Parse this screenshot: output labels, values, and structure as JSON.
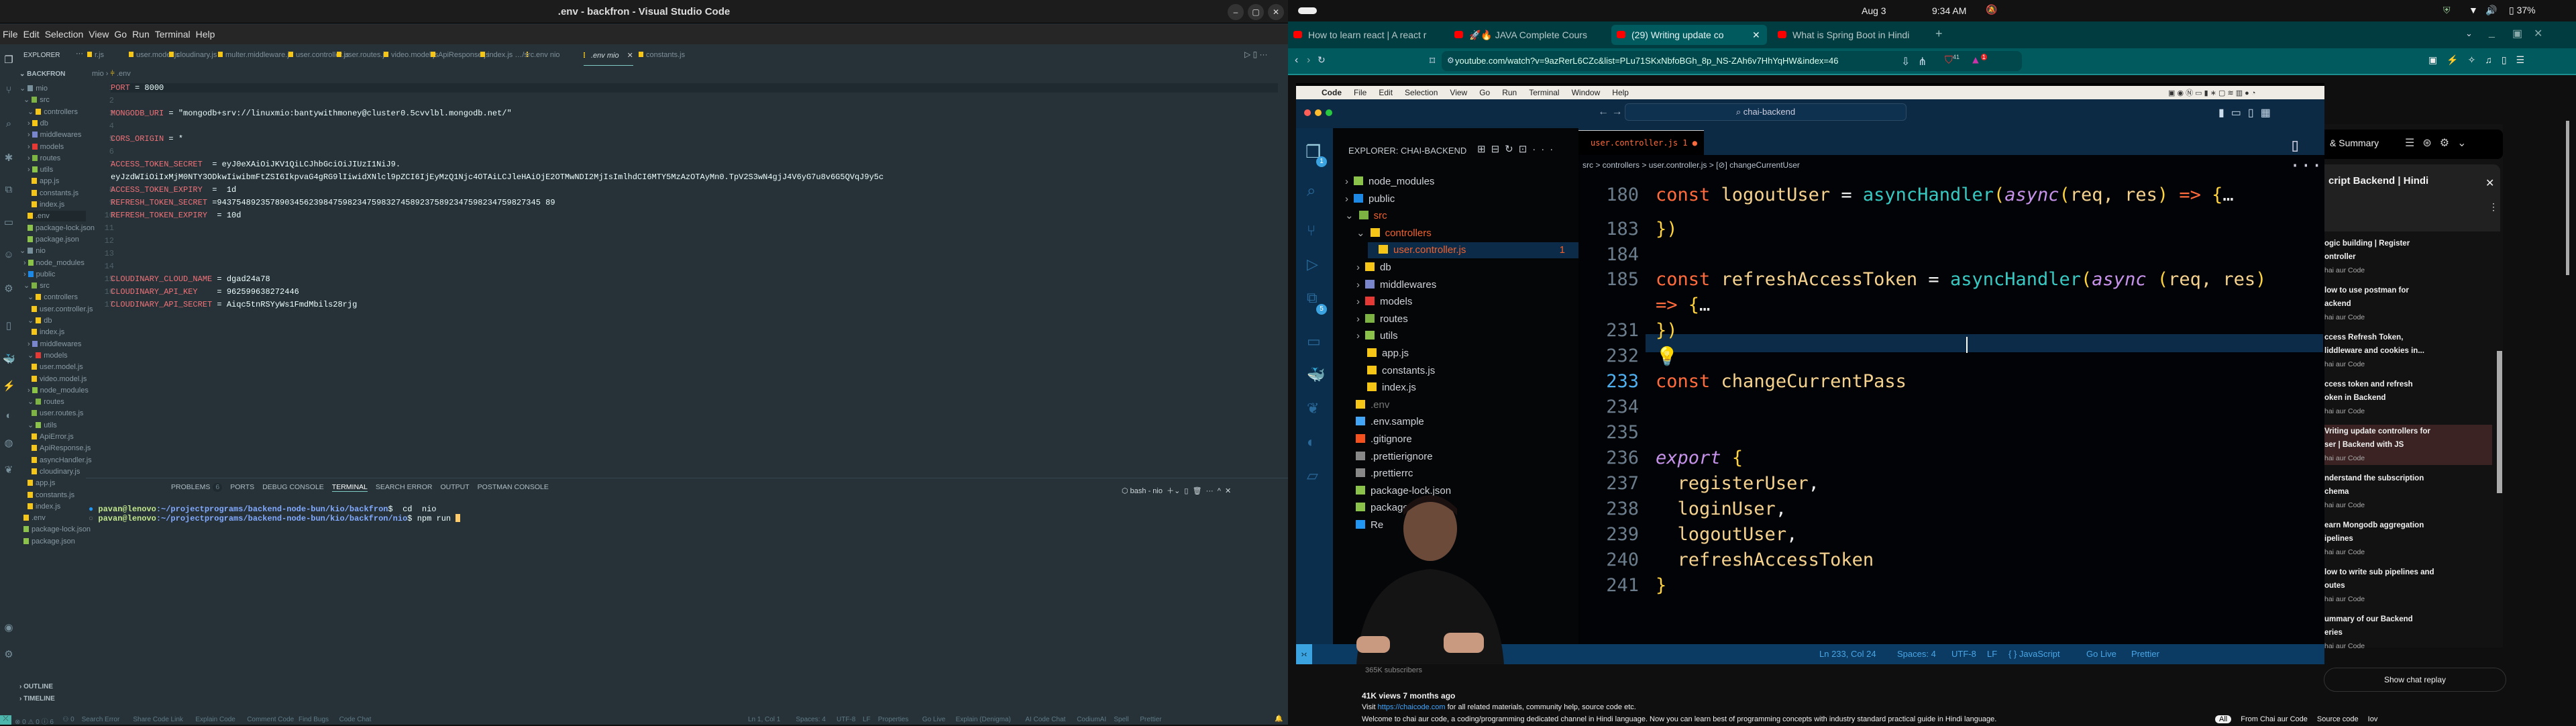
{
  "vscode": {
    "title": ".env - backfron - Visual Studio Code",
    "menu": [
      "File",
      "Edit",
      "Selection",
      "View",
      "Go",
      "Run",
      "Terminal",
      "Help"
    ],
    "explorer_label": "EXPLORER",
    "root": "BACKFRON",
    "tree": [
      {
        "d": 0,
        "t": "mio",
        "c": "#78909c",
        "chev": "v"
      },
      {
        "d": 1,
        "t": "src",
        "c": "#7cb342",
        "chev": "v"
      },
      {
        "d": 2,
        "t": "controllers",
        "c": "#f5c518",
        "chev": "v"
      },
      {
        "d": 2,
        "t": "db",
        "c": "#f5c518",
        "chev": ">"
      },
      {
        "d": 2,
        "t": "middlewares",
        "c": "#7986cb",
        "chev": ">"
      },
      {
        "d": 2,
        "t": "models",
        "c": "#e53935",
        "chev": ">"
      },
      {
        "d": 2,
        "t": "routes",
        "c": "#7cb342",
        "chev": ">"
      },
      {
        "d": 2,
        "t": "utils",
        "c": "#8bc34a",
        "chev": ">"
      },
      {
        "d": 3,
        "t": "app.js",
        "c": "#f5c518"
      },
      {
        "d": 3,
        "t": "constants.js",
        "c": "#f5c518"
      },
      {
        "d": 3,
        "t": "index.js",
        "c": "#f5c518"
      },
      {
        "d": 2,
        "t": ".env",
        "c": "#f5c518",
        "sel": true
      },
      {
        "d": 2,
        "t": "package-lock.json",
        "c": "#8bc34a"
      },
      {
        "d": 2,
        "t": "package.json",
        "c": "#8bc34a"
      },
      {
        "d": 0,
        "t": "nio",
        "c": "#78909c",
        "chev": "v"
      },
      {
        "d": 1,
        "t": "node_modules",
        "c": "#8bc34a",
        "chev": ">"
      },
      {
        "d": 1,
        "t": "public",
        "c": "#1e88e5",
        "chev": ">"
      },
      {
        "d": 1,
        "t": "src",
        "c": "#7cb342",
        "chev": "v"
      },
      {
        "d": 2,
        "t": "controllers",
        "c": "#f5c518",
        "chev": "v"
      },
      {
        "d": 3,
        "t": "user.controller.js",
        "c": "#f5c518"
      },
      {
        "d": 2,
        "t": "db",
        "c": "#f5c518",
        "chev": "v"
      },
      {
        "d": 3,
        "t": "index.js",
        "c": "#f5c518"
      },
      {
        "d": 2,
        "t": "middlewares",
        "c": "#7986cb",
        "chev": ">"
      },
      {
        "d": 2,
        "t": "models",
        "c": "#e53935",
        "chev": "v"
      },
      {
        "d": 3,
        "t": "user.model.js",
        "c": "#f5c518"
      },
      {
        "d": 3,
        "t": "video.model.js",
        "c": "#f5c518"
      },
      {
        "d": 2,
        "t": "node_modules",
        "c": "#8bc34a",
        "chev": ">"
      },
      {
        "d": 2,
        "t": "routes",
        "c": "#7cb342",
        "chev": "v"
      },
      {
        "d": 3,
        "t": "user.routes.js",
        "c": "#7cb342"
      },
      {
        "d": 2,
        "t": "utils",
        "c": "#8bc34a",
        "chev": "v"
      },
      {
        "d": 3,
        "t": "ApiError.js",
        "c": "#f5c518"
      },
      {
        "d": 3,
        "t": "ApiResponse.js",
        "c": "#f5c518"
      },
      {
        "d": 3,
        "t": "asyncHandler.js",
        "c": "#f5c518"
      },
      {
        "d": 3,
        "t": "cloudinary.js",
        "c": "#f5c518"
      },
      {
        "d": 2,
        "t": "app.js",
        "c": "#f5c518"
      },
      {
        "d": 2,
        "t": "constants.js",
        "c": "#f5c518"
      },
      {
        "d": 2,
        "t": "index.js",
        "c": "#f5c518"
      },
      {
        "d": 1,
        "t": ".env",
        "c": "#f5c518"
      },
      {
        "d": 1,
        "t": "package-lock.json",
        "c": "#8bc34a"
      },
      {
        "d": 1,
        "t": "package.json",
        "c": "#8bc34a"
      }
    ],
    "outline": "OUTLINE",
    "timeline": "TIMELINE",
    "tabs": [
      "r.js",
      "user.model.js",
      "cloudinary.js",
      "multer.middleware.js",
      "user.controller.js",
      "user.routes.js",
      "video.model.js",
      "ApiResponse.js",
      "index.js …/src",
      ".env nio",
      ".env mio",
      "constants.js"
    ],
    "breadcrumb": [
      "mio",
      ".env"
    ],
    "code": [
      {
        "n": "1",
        "k": "PORT",
        "v": " = 8000"
      },
      {
        "n": "2",
        "k": "",
        "v": ""
      },
      {
        "n": "3",
        "k": "MONGODB_URI",
        "v": " = \"mongodb+srv://linuxmio:bantywithmoney@cluster0.5cvvlbl.mongodb.net/\""
      },
      {
        "n": "4",
        "k": "",
        "v": ""
      },
      {
        "n": "5",
        "k": "CORS_ORIGIN",
        "v": " = *"
      },
      {
        "n": "6",
        "k": "",
        "v": ""
      },
      {
        "n": "7",
        "k": "ACCESS_TOKEN_SECRET",
        "v": "  = eyJ0eXAiOiJKV1QiLCJhbGciOiJIUzI1NiJ9."
      },
      {
        "n": "",
        "k": "",
        "v": "eyJzdWIiOiIxMjM0NTY3ODkwIiwibmFtZSI6IkpvaG4gRG9lIiwidXNlcl9pZCI6IjEyMzQ1Njc4OTAiLCJleHAiOjE2OTMwNDI2MjIsImlhdCI6MTY5MzAzOTAyMn0.TpV2S3wN4gjJ4V6yG7u8v6G5QVqJ9y5c"
      },
      {
        "n": "8",
        "k": "ACCESS_TOKEN_EXPIRY",
        "v": "  =  1d"
      },
      {
        "n": "9",
        "k": "REFRESH_TOKEN_SECRET",
        "v": " =9437548923578903456239847598234759832745892375892347598234759827345 89"
      },
      {
        "n": "10",
        "k": "REFRESH_TOKEN_EXPIRY",
        "v": "  = 10d"
      },
      {
        "n": "11",
        "k": "",
        "v": ""
      },
      {
        "n": "12",
        "k": "",
        "v": ""
      },
      {
        "n": "13",
        "k": "",
        "v": ""
      },
      {
        "n": "14",
        "k": "",
        "v": ""
      },
      {
        "n": "15",
        "k": "CLOUDINARY_CLOUD_NAME",
        "v": " = dgad24a78"
      },
      {
        "n": "16",
        "k": "CLOUDINARY_API_KEY",
        "v": "    = 962599638272446"
      },
      {
        "n": "17",
        "k": "CLOUDINARY_API_SECRET",
        "v": " = Aiqc5tnRSYyWs1FmdMbils28rjg"
      }
    ],
    "panel_tabs": [
      "PROBLEMS",
      "6",
      "PORTS",
      "DEBUG CONSOLE",
      "TERMINAL",
      "SEARCH ERROR",
      "OUTPUT",
      "POSTMAN CONSOLE"
    ],
    "terminal_name": "bash - nio",
    "terminal": [
      {
        "user": "pavan@lenovo",
        "path": ":~/projectprograms/backend-node-bun/kio/backfron",
        "cmd": "$  cd  nio"
      },
      {
        "user": "pavan@lenovo",
        "path": ":~/projectprograms/backend-node-bun/kio/backfron/nio",
        "cmd": "$ npm run "
      }
    ],
    "status_left": [
      "⊗ 0 ⚠ 0 ⓘ 6",
      "⚇ 0",
      "Search Error",
      "Share Code Link",
      "Explain Code",
      "Comment Code",
      "Find Bugs",
      "Code Chat"
    ],
    "status_right": [
      "Ln 1, Col 1",
      "Spaces: 4",
      "UTF-8",
      "LF",
      "Properties",
      "Go Live",
      "Explain (Denigma)",
      "AI Code Chat",
      "CodiumAI",
      "Spell",
      "Prettier"
    ]
  },
  "system": {
    "date": "Aug 3",
    "time": "9:34 AM",
    "battery": "37%"
  },
  "browser": {
    "tabs": [
      "How to learn react | A react r",
      "🚀🔥 JAVA Complete Cours",
      "(29) Writing update co",
      "What is Spring Boot in Hindi"
    ],
    "new_tab": "+",
    "url": "youtube.com/watch?v=9azRerL6CZc&list=PLu71SKxNbfoBGh_8p_NS-ZAh6v7HhYqHW&index=46",
    "badge_brave": "41",
    "badge_alert": "1",
    "yt_badge": "9+"
  },
  "video": {
    "mac_menu": [
      "Code",
      "File",
      "Edit",
      "Selection",
      "View",
      "Go",
      "Run",
      "Terminal",
      "Window",
      "Help"
    ],
    "search": "chai-backend",
    "explorer_title": "EXPLORER: CHAI-BACKEND",
    "badge1": "1",
    "badge5": "5",
    "tree": [
      {
        "d": 0,
        "t": "node_modules",
        "c": "#8bc34a",
        "chev": ">"
      },
      {
        "d": 0,
        "t": "public",
        "c": "#1e88e5",
        "chev": ">"
      },
      {
        "d": 0,
        "t": "src",
        "c": "#7cb342",
        "chev": "v",
        "o": true
      },
      {
        "d": 1,
        "t": "controllers",
        "c": "#f5c518",
        "chev": "v",
        "o": true
      },
      {
        "d": 2,
        "t": "user.controller.js",
        "c": "#f5c518",
        "o": true,
        "sel": true,
        "badge": "1"
      },
      {
        "d": 1,
        "t": "db",
        "c": "#f5c518",
        "chev": ">"
      },
      {
        "d": 1,
        "t": "middlewares",
        "c": "#7986cb",
        "chev": ">"
      },
      {
        "d": 1,
        "t": "models",
        "c": "#e53935",
        "chev": ">"
      },
      {
        "d": 1,
        "t": "routes",
        "c": "#7cb342",
        "chev": ">"
      },
      {
        "d": 1,
        "t": "utils",
        "c": "#8bc34a",
        "chev": ">"
      },
      {
        "d": 1,
        "t": "app.js",
        "c": "#f5c518"
      },
      {
        "d": 1,
        "t": "constants.js",
        "c": "#f5c518"
      },
      {
        "d": 1,
        "t": "index.js",
        "c": "#f5c518"
      },
      {
        "d": 0,
        "t": ".env",
        "c": "#f5c518",
        "dim": true
      },
      {
        "d": 0,
        "t": ".env.sample",
        "c": "#42a5f5"
      },
      {
        "d": 0,
        "t": ".gitignore",
        "c": "#f4511e"
      },
      {
        "d": 0,
        "t": ".prettierignore",
        "c": "#888"
      },
      {
        "d": 0,
        "t": ".prettierrc",
        "c": "#888"
      },
      {
        "d": 0,
        "t": "package-lock.json",
        "c": "#8bc34a"
      },
      {
        "d": 0,
        "t": "package.json",
        "c": "#8bc34a"
      },
      {
        "d": 0,
        "t": "Re",
        "c": "#2196f3"
      }
    ],
    "tab": "user.controller.js 1",
    "breadcrumb": "src > controllers > user.controller.js > [⊘] changeCurrentUser",
    "code": [
      {
        "n": "180",
        "h": "<span class='kw'>const</span> <span class='id'>logoutUser</span> <span class='pl'>=</span> <span class='fn'>asyncHandler</span><span class='br'>(</span><span class='as'>async</span><span class='br'>(</span><span class='id'>req, res</span><span class='br'>)</span> <span class='kw'>=></span> <span class='br'>{</span>…"
      },
      {
        "n": "183",
        "h": "<span class='br'>})</span>"
      },
      {
        "n": "184",
        "h": ""
      },
      {
        "n": "185",
        "h": "<span class='kw'>const</span> <span class='id'>refreshAccessToken</span> <span class='pl'>=</span> <span class='fn'>asyncHandler</span><span class='br'>(</span><span class='as'>async</span> <span class='br'>(</span><span class='id'>req, res</span><span class='br'>)</span>"
      },
      {
        "n": "",
        "h": "<span class='kw'>=></span> <span class='br'>{</span>…"
      },
      {
        "n": "231",
        "h": "<span class='br'>})</span>"
      },
      {
        "n": "232",
        "h": "<span class='br'>💡</span>"
      },
      {
        "n": "233",
        "h": "<span class='kw'>const</span> <span class='id'>changeCurrentPass</span>"
      },
      {
        "n": "234",
        "h": ""
      },
      {
        "n": "235",
        "h": ""
      },
      {
        "n": "236",
        "h": "<span class='ex'>export</span> <span class='br'>{</span>"
      },
      {
        "n": "237",
        "h": "  <span class='id'>registerUser</span><span class='pl'>,</span>"
      },
      {
        "n": "238",
        "h": "  <span class='id'>loginUser</span><span class='pl'>,</span>"
      },
      {
        "n": "239",
        "h": "  <span class='id'>logoutUser</span><span class='pl'>,</span>"
      },
      {
        "n": "240",
        "h": "  <span class='id'>refreshAccessToken</span>"
      },
      {
        "n": "241",
        "h": "<span class='br'>}</span>"
      }
    ],
    "status": [
      "Ln 233, Col 24",
      "Spaces: 4",
      "UTF-8",
      "LF",
      "{ } JavaScript",
      "Go Live",
      "Prettier"
    ]
  },
  "youtube": {
    "panel_header": "& Summary",
    "playlist_title": "cript Backend | Hindi",
    "items": [
      {
        "t1": "ogic building | Register",
        "t2": "ontroller",
        "ch": "hai aur Code"
      },
      {
        "t1": "low to use postman for",
        "t2": "ackend",
        "ch": "hai aur Code"
      },
      {
        "t1": "ccess Refresh Token,",
        "t2": "liddleware and cookies in...",
        "ch": "hai aur Code"
      },
      {
        "t1": "ccess token and refresh",
        "t2": "oken in Backend",
        "ch": "hai aur Code"
      },
      {
        "t1": "Vriting update controllers for",
        "t2": "ser | Backend with JS",
        "ch": "hai aur Code",
        "active": true
      },
      {
        "t1": "nderstand the subscription",
        "t2": "chema",
        "ch": "hai aur Code"
      },
      {
        "t1": "earn Mongodb aggregation",
        "t2": "ipelines",
        "ch": "hai aur Code"
      },
      {
        "t1": "low to write sub pipelines and",
        "t2": "outes",
        "ch": "hai aur Code"
      },
      {
        "t1": "ummary of our Backend",
        "t2": "eries",
        "ch": "hai aur Code"
      }
    ],
    "show_chat": "Show chat replay",
    "subscribers": "365K subscribers",
    "views": "41K views  7 months ago",
    "desc1_pre": "Visit ",
    "desc1_link": "https://chaicode.com",
    "desc1_post": " for all related materials, community help, source code etc.",
    "desc2": "Welcome to chai aur code, a coding/programming dedicated channel in Hindi language. Now you can learn best of programming concepts with industry standard practical guide in Hindi language.",
    "chips": [
      "All",
      "From Chai aur Code",
      "Source code",
      "Iov"
    ]
  },
  "colors": {
    "accent": "#80cbc4",
    "browser_bar": "#015a5e",
    "active_playlist": "#3a2322"
  }
}
